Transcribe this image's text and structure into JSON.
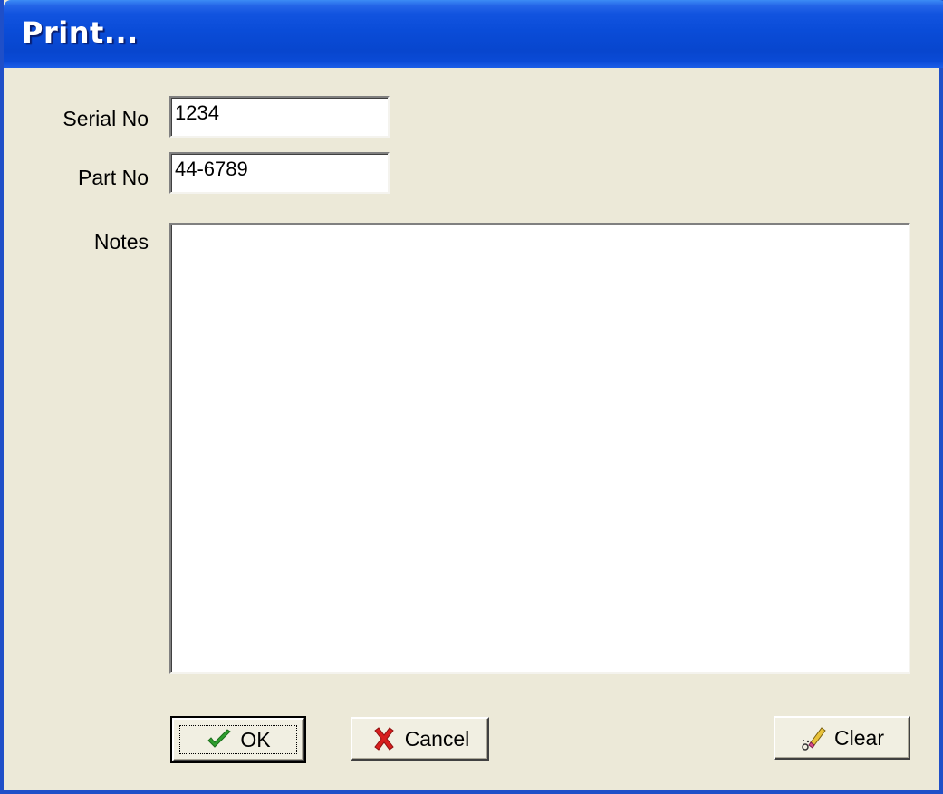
{
  "window": {
    "title": "Print..."
  },
  "form": {
    "serial": {
      "label": "Serial No",
      "value": "1234"
    },
    "part": {
      "label": "Part No",
      "value": "44-6789"
    },
    "notes": {
      "label": "Notes",
      "value": ""
    }
  },
  "buttons": {
    "ok": {
      "label": "OK",
      "icon": "checkmark-icon"
    },
    "cancel": {
      "label": "Cancel",
      "icon": "x-mark-icon"
    },
    "clear": {
      "label": "Clear",
      "icon": "eraser-icon"
    }
  },
  "colors": {
    "titlebar": "#0A4CD8",
    "dialog_bg": "#ECE9D8",
    "ok_icon": "#2E9E2E",
    "cancel_icon": "#D81E1E"
  }
}
